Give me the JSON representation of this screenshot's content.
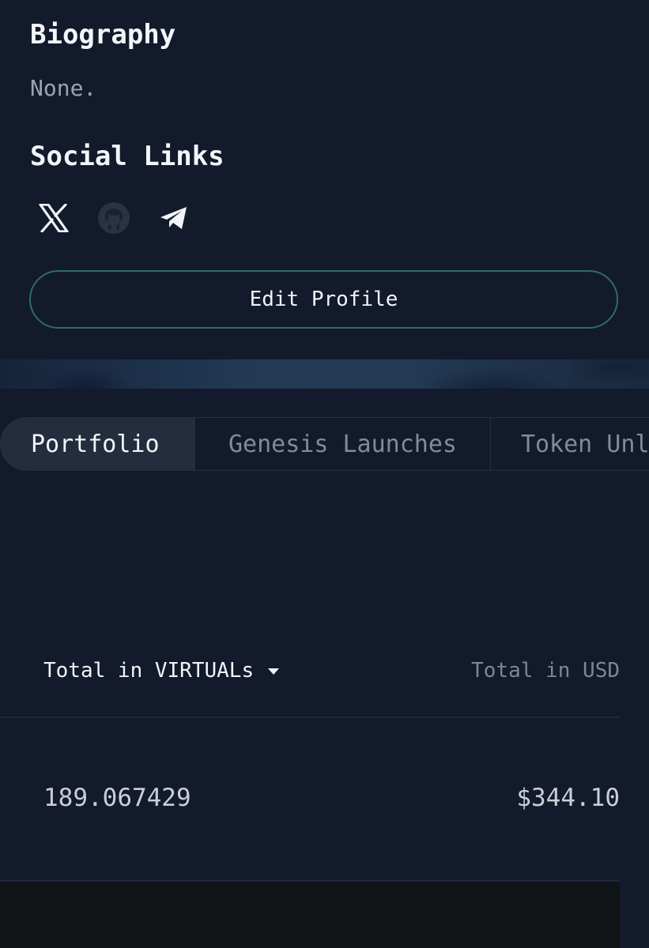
{
  "profile": {
    "biography_heading": "Biography",
    "biography_text": "None.",
    "social_heading": "Social Links",
    "social_links": [
      {
        "name": "x",
        "icon": "x-icon"
      },
      {
        "name": "github",
        "icon": "github-icon"
      },
      {
        "name": "telegram",
        "icon": "telegram-icon"
      }
    ],
    "edit_button_label": "Edit Profile"
  },
  "tabs": [
    {
      "label": "Portfolio",
      "active": true
    },
    {
      "label": "Genesis Launches",
      "active": false
    },
    {
      "label": "Token Unl",
      "active": false
    }
  ],
  "portfolio": {
    "total_virtuals_label": "Total in VIRTUALs",
    "total_usd_label": "Total in USD",
    "total_virtuals_value": "189.067429",
    "total_usd_value": "$344.10"
  },
  "colors": {
    "background": "#121a2b",
    "accent_border": "#2f6b68",
    "active_tab_bg": "#232d3d",
    "muted_text": "#838b96"
  }
}
